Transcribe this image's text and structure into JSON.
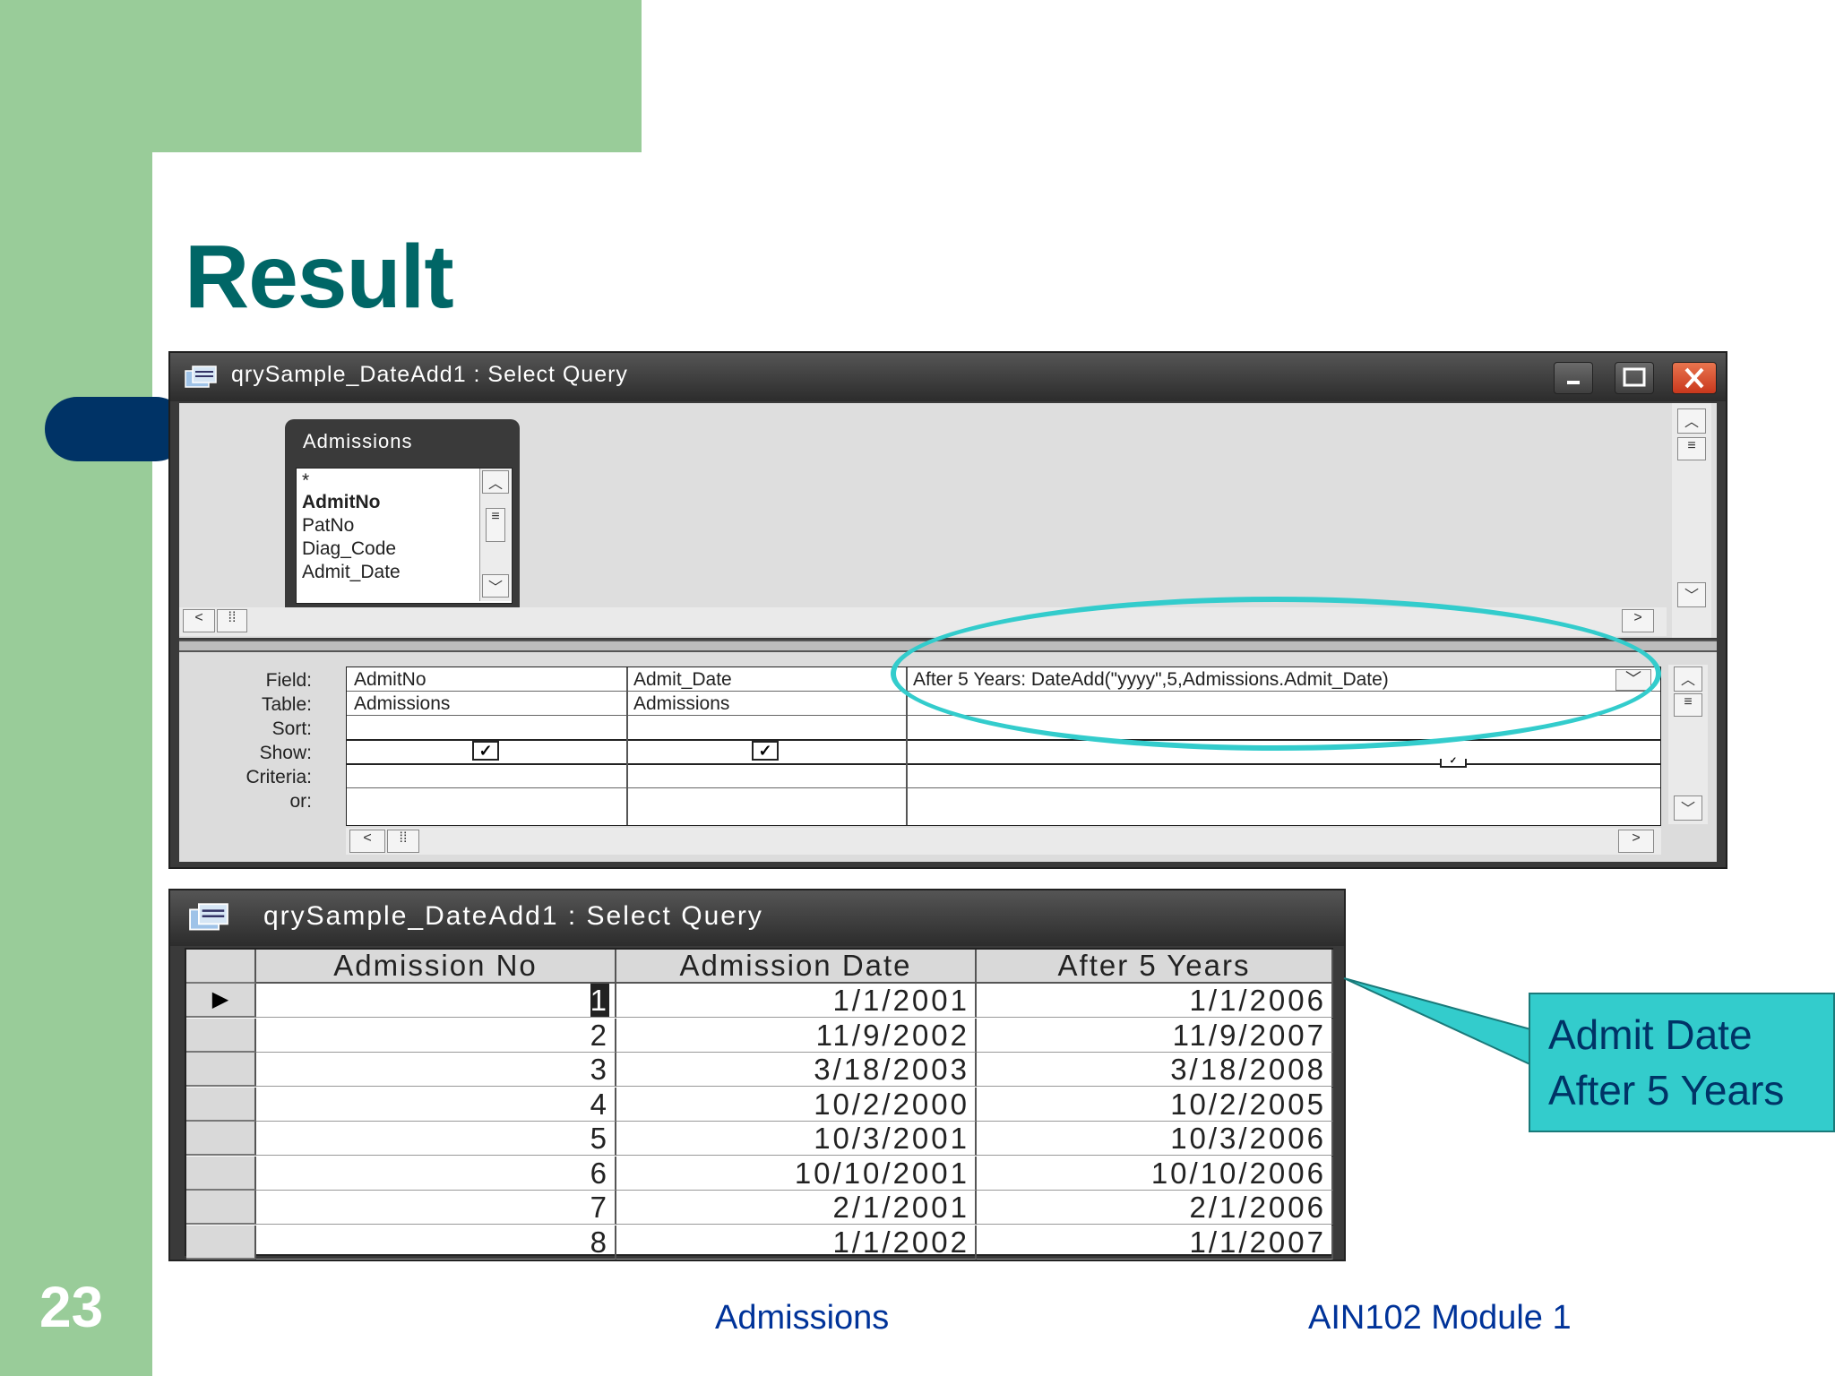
{
  "slide": {
    "title": "Result",
    "number": "23",
    "footer_center": "Admissions",
    "footer_right": "AIN102  Module 1"
  },
  "design_window": {
    "title": "qrySample_DateAdd1 : Select Query",
    "field_list": {
      "title": "Admissions",
      "items": [
        "*",
        "AdmitNo",
        "PatNo",
        "Diag_Code",
        "Admit_Date"
      ]
    },
    "row_labels": [
      "Field:",
      "Table:",
      "Sort:",
      "Show:",
      "Criteria:",
      "or:"
    ],
    "columns": [
      {
        "field": "AdmitNo",
        "table": "Admissions",
        "show": true
      },
      {
        "field": "Admit_Date",
        "table": "Admissions",
        "show": true
      },
      {
        "field": "After 5 Years: DateAdd(\"yyyy\",5,Admissions.Admit_Date)",
        "table": "",
        "show": true
      }
    ]
  },
  "datasheet_window": {
    "title": "qrySample_DateAdd1 : Select Query",
    "headers": [
      "Admission No",
      "Admission Date",
      "After 5 Years"
    ],
    "rows": [
      [
        "1",
        "1/1/2001",
        "1/1/2006"
      ],
      [
        "2",
        "11/9/2002",
        "11/9/2007"
      ],
      [
        "3",
        "3/18/2003",
        "3/18/2008"
      ],
      [
        "4",
        "10/2/2000",
        "10/2/2005"
      ],
      [
        "5",
        "10/3/2001",
        "10/3/2006"
      ],
      [
        "6",
        "10/10/2001",
        "10/10/2006"
      ],
      [
        "7",
        "2/1/2001",
        "2/1/2006"
      ],
      [
        "8",
        "1/1/2002",
        "1/1/2007"
      ]
    ],
    "current_row_marker": "▶"
  },
  "callout": {
    "line1": "Admit Date",
    "line2": "After 5 Years"
  },
  "colors": {
    "green_bar": "#99cc99",
    "title_teal": "#006666",
    "navy": "#003366",
    "callout_fill": "#33cccc",
    "footer_blue": "#003399"
  }
}
